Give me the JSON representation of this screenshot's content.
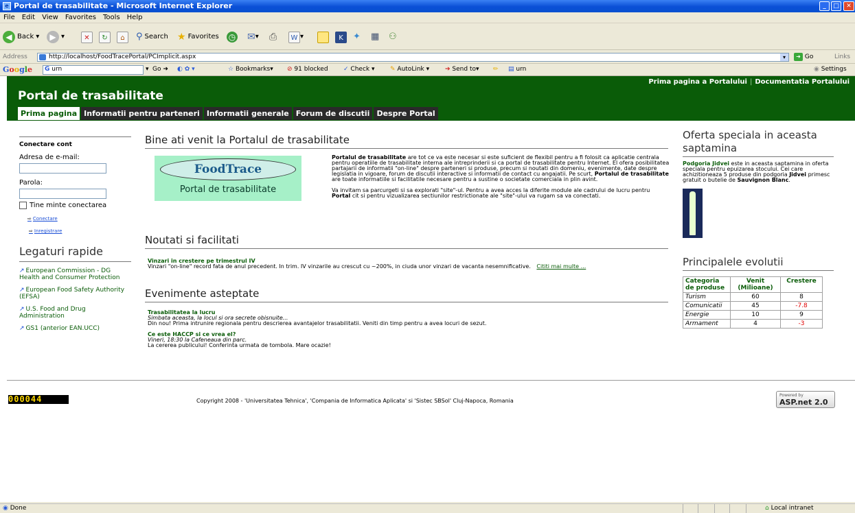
{
  "window": {
    "title": "Portal de trasabilitate - Microsoft Internet Explorer"
  },
  "menu": [
    "File",
    "Edit",
    "View",
    "Favorites",
    "Tools",
    "Help"
  ],
  "toolbar": {
    "back_label": "Back",
    "search_label": "Search",
    "favorites_label": "Favorites"
  },
  "address": {
    "label": "Address",
    "url": "http://localhost/FoodTracePortal/PCImplicit.aspx",
    "go_label": "Go",
    "links_label": "Links"
  },
  "googlebar": {
    "search_value": "urn",
    "go_label": "Go",
    "bookmarks_label": "Bookmarks",
    "blocked_label": "91 blocked",
    "check_label": "Check",
    "autolink_label": "AutoLink",
    "sendto_label": "Send to",
    "urn_label": "urn",
    "settings_label": "Settings"
  },
  "site": {
    "title": "Portal de trasabilitate",
    "toplinks": [
      "Prima pagina a Portalului",
      "Documentatia Portalului"
    ],
    "nav": [
      "Prima pagina",
      "Informatii pentru parteneri",
      "Informatii generale",
      "Forum de discutii",
      "Despre Portal"
    ]
  },
  "login": {
    "heading": "Conectare cont",
    "email_label": "Adresa de e-mail:",
    "password_label": "Parola:",
    "remember_label": "Tine minte conectarea",
    "connect_link": "Conectare",
    "register_link": "Inregistrare"
  },
  "quicklinks": {
    "heading": "Legaturi rapide",
    "items": [
      "European Commission - DG Health and Consumer Protection",
      "European Food Safety Authority (EFSA)",
      "U.S. Food and Drug Administration",
      "GS1 (anterior EAN.UCC)"
    ]
  },
  "welcome": {
    "title": "Bine ati venit la Portalul de trasabilitate",
    "logo_name": "FoodTrace",
    "logo_sub": "Portal de trasabilitate",
    "p1_bold": "Portalul de trasabilitate",
    "p1_text": " are tot ce va este necesar si este suficient de flexibil pentru a fi folosit ca aplicatie centrala pentru operatiile de trasabilitate interna ale intreprinderii si ca portal de trasabilitate pentru Internet. El ofera posibilitatea partajarii de informatii \"on-line\" despre parteneri si produse, precum si noutati din domeniu, evenimente, date despre legislatia in vigoare, forum de discutii interactive si informatii de contact cu angajatii. Pe scurt, ",
    "p1_bold2": "Portalul de trasabilitate",
    "p1_text2": " are toate informatiile si facilitatile necesare pentru a sustine o societate comerciala in plin avint.",
    "p2_text": "Va invitam sa parcurgeti si sa explorati \"site\"-ul. Pentru a avea acces la diferite module ale cadrului de lucru pentru ",
    "p2_bold": "Portal",
    "p2_text2": " cit si pentru vizualizarea sectiunilor restrictionate ale \"site\"-ului va rugam sa va conectati."
  },
  "news": {
    "title": "Noutati si facilitati",
    "item_title": "Vinzari in crestere pe trimestrul IV",
    "item_text": "Vinzari \"on-line\" record fata de anul precedent. In trim. IV vinzarile au crescut cu ~200%, in ciuda unor vinzari de vacanta nesemnificative.",
    "more_link": "Cititi mai multe ..."
  },
  "events": {
    "title": "Evenimente asteptate",
    "items": [
      {
        "title": "Trasabilitatea la lucru",
        "subtitle": "Simbata aceasta, la locul si ora secrete obisnuite...",
        "text": "Din nou! Prima intrunire regionala pentru descrierea avantajelor trasabilitatii. Veniti din timp pentru a avea locuri de sezut."
      },
      {
        "title": "Ce este HACCP si ce vrea el?",
        "subtitle": "Vineri, 18:30 la Cafeneaua din parc.",
        "text": "La cererea publicului! Conferinta urmata de tombola. Mare ocazie!"
      }
    ]
  },
  "offer": {
    "title": "Oferta speciala in aceasta saptamina",
    "bold1": "Podgoria Jidvei",
    "text1": " este in aceasta saptamina in oferta speciala pentru epuizarea stocului. Cei care achizitioneaza 5 produse din podgoria ",
    "bold2": "Jidvei",
    "text2": " primesc gratuit o butelie de ",
    "bold3": "Sauvignon Blanc",
    "text3": "."
  },
  "evolution": {
    "title": "Principalele evolutii",
    "headers": [
      "Categoria de produse",
      "Venit (Milioane)",
      "Crestere"
    ],
    "rows": [
      {
        "category": "Turism",
        "income": "60",
        "growth": "8",
        "negative": false
      },
      {
        "category": "Comunicatii",
        "income": "45",
        "growth": "-7.8",
        "negative": true
      },
      {
        "category": "Energie",
        "income": "10",
        "growth": "9",
        "negative": false
      },
      {
        "category": "Armament",
        "income": "4",
        "growth": "-3",
        "negative": true
      }
    ]
  },
  "footer": {
    "counter": "000044",
    "copyright": "Copyright 2008 - 'Universitatea Tehnica', 'Compania de Informatica Aplicata' si 'Sistec SBSol' Cluj-Napoca, Romania",
    "powered_small": "Powered by",
    "powered_big": "ASP.net 2.0"
  },
  "status": {
    "left": "Done",
    "right": "Local intranet"
  },
  "colors": {
    "site_green": "#0a5c08",
    "ie_blue": "#0a4fd6",
    "negative_red": "#e00000"
  }
}
